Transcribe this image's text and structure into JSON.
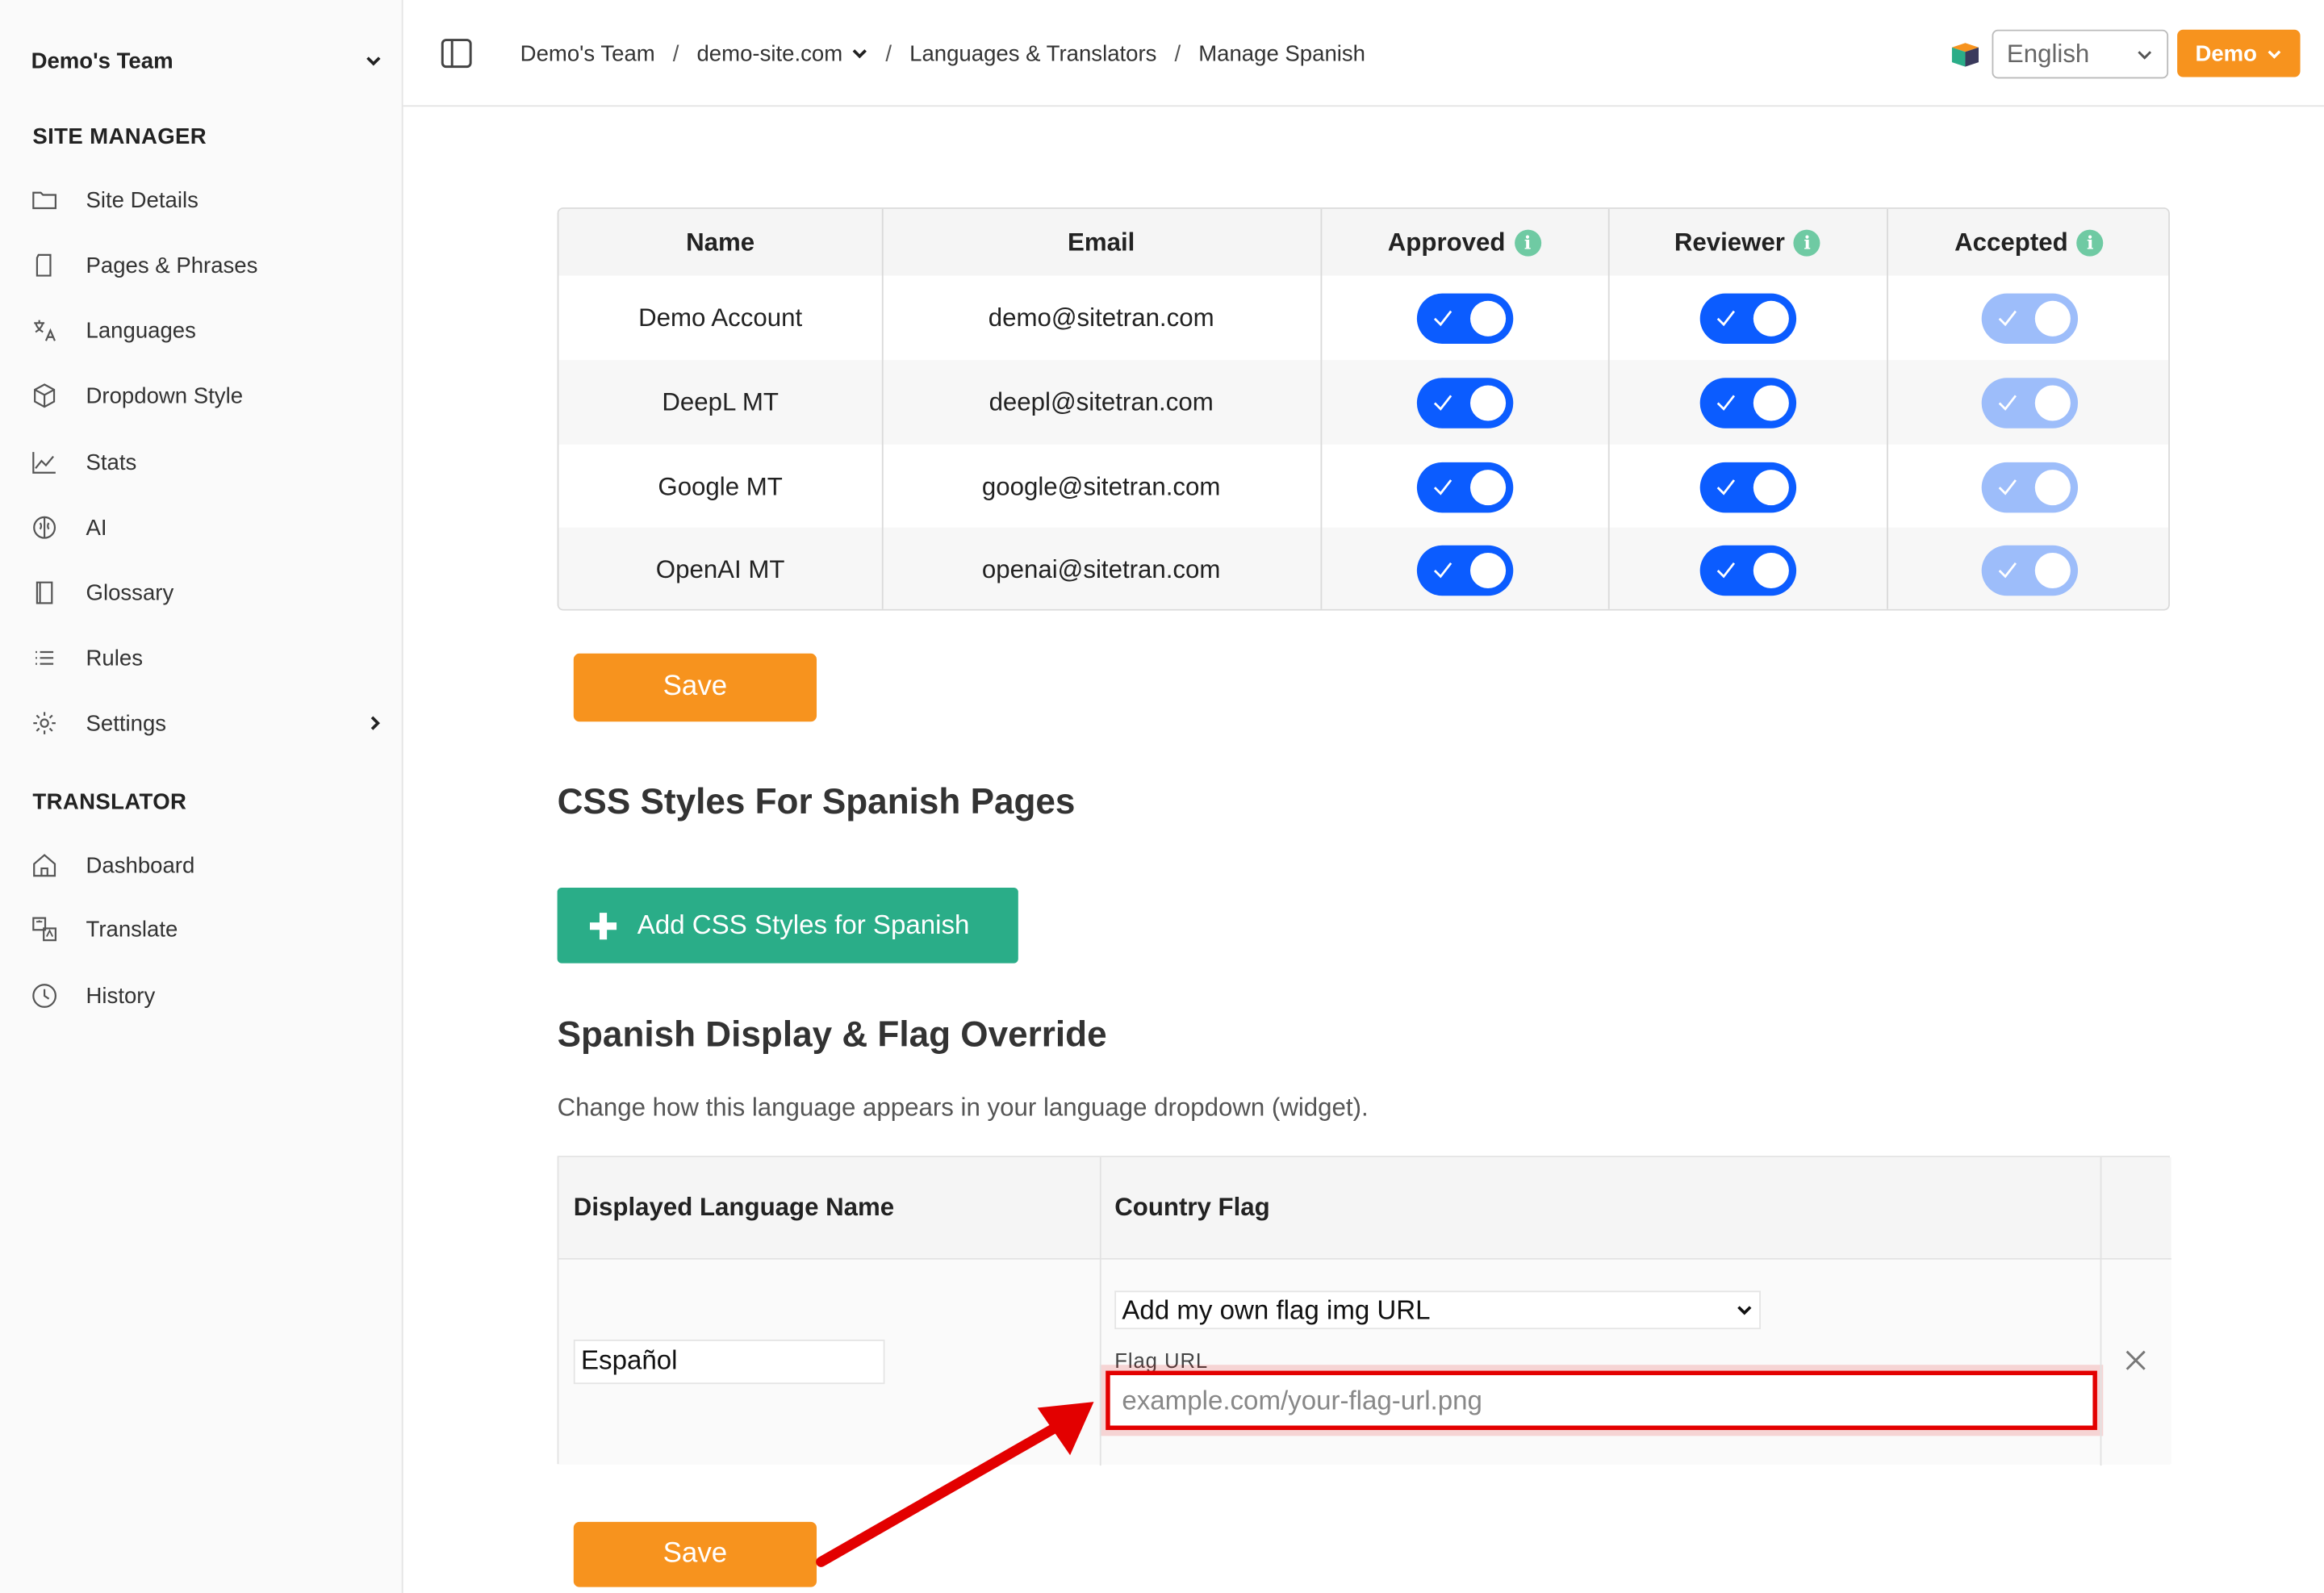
{
  "sidebar": {
    "team_name": "Demo's Team",
    "site_manager_title": "SITE MANAGER",
    "site_manager_items": [
      {
        "label": "Site Details",
        "icon": "folder-icon"
      },
      {
        "label": "Pages & Phrases",
        "icon": "page-icon"
      },
      {
        "label": "Languages",
        "icon": "translate-icon"
      },
      {
        "label": "Dropdown Style",
        "icon": "cube-icon"
      },
      {
        "label": "Stats",
        "icon": "chart-icon"
      },
      {
        "label": "AI",
        "icon": "brain-icon"
      },
      {
        "label": "Glossary",
        "icon": "book-icon"
      },
      {
        "label": "Rules",
        "icon": "list-icon"
      },
      {
        "label": "Settings",
        "icon": "gear-icon"
      }
    ],
    "translator_title": "TRANSLATOR",
    "translator_items": [
      {
        "label": "Dashboard",
        "icon": "home-icon"
      },
      {
        "label": "Translate",
        "icon": "translate-doc-icon"
      },
      {
        "label": "History",
        "icon": "clock-icon"
      }
    ]
  },
  "header": {
    "breadcrumbs": [
      "Demo's Team",
      "demo-site.com",
      "Languages & Translators",
      "Manage Spanish"
    ],
    "language_select": "English",
    "demo_button": "Demo"
  },
  "translators_table": {
    "columns": [
      "Name",
      "Email",
      "Approved",
      "Reviewer",
      "Accepted"
    ],
    "rows": [
      {
        "name": "Demo Account",
        "email": "demo@sitetran.com",
        "approved": true,
        "reviewer": true,
        "accepted": true
      },
      {
        "name": "DeepL MT",
        "email": "deepl@sitetran.com",
        "approved": true,
        "reviewer": true,
        "accepted": true
      },
      {
        "name": "Google MT",
        "email": "google@sitetran.com",
        "approved": true,
        "reviewer": true,
        "accepted": true
      },
      {
        "name": "OpenAI MT",
        "email": "openai@sitetran.com",
        "approved": true,
        "reviewer": true,
        "accepted": true
      }
    ],
    "save_label": "Save"
  },
  "css_section": {
    "title": "CSS Styles For Spanish Pages",
    "add_button": "Add CSS Styles for Spanish"
  },
  "flag_section": {
    "title": "Spanish Display & Flag Override",
    "description": "Change how this language appears in your language dropdown (widget).",
    "col_name": "Displayed Language Name",
    "col_flag": "Country Flag",
    "name_value": "Español",
    "flag_option": "Add my own flag img URL",
    "flag_url_label": "Flag URL",
    "flag_url_placeholder": "example.com/your-flag-url.png",
    "save_label": "Save"
  },
  "colors": {
    "accent_orange": "#f7931e",
    "toggle_blue": "#0b5cff",
    "toggle_disabled": "#9dbdfa",
    "add_green": "#2aad88",
    "highlight_red": "#e30000"
  }
}
